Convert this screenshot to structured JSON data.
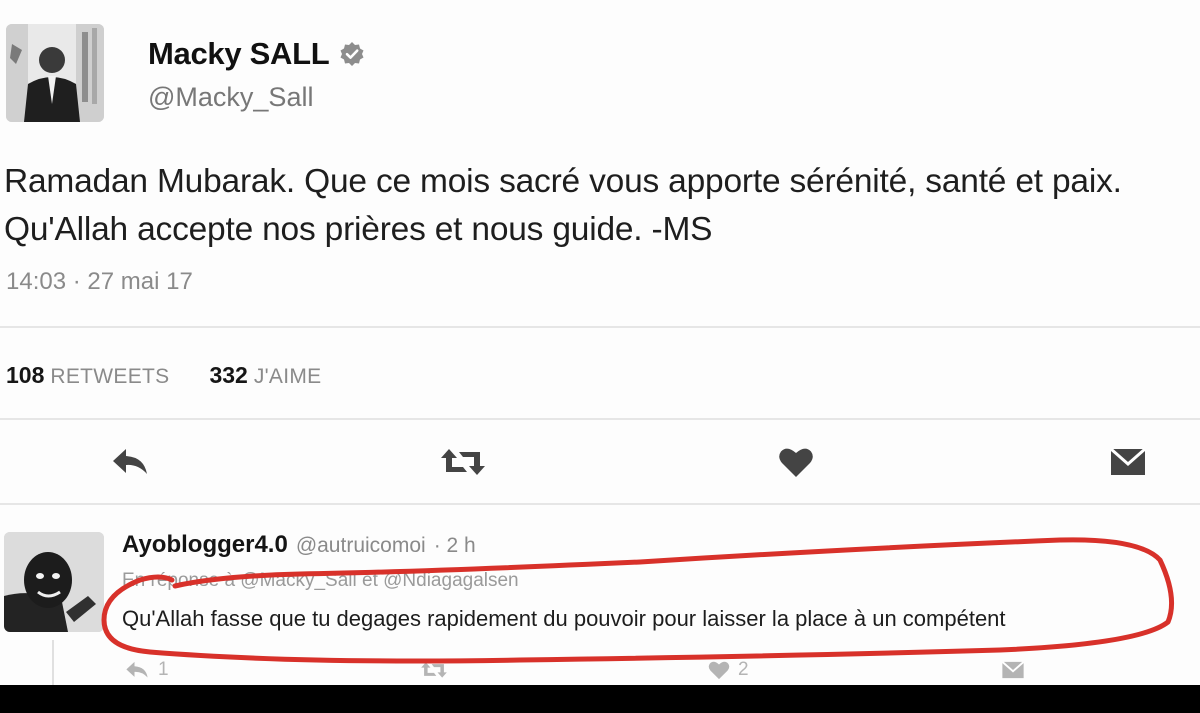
{
  "tweet": {
    "author_name": "Macky SALL",
    "author_handle": "@Macky_Sall",
    "text": "Ramadan Mubarak. Que ce mois sacré vous apporte sérénité, santé et paix. Qu'Allah accepte nos prières et nous guide. -MS",
    "timestamp": "14:03 · 27 mai 17",
    "retweets_count": "108",
    "retweets_label": "RETWEETS",
    "likes_count": "332",
    "likes_label": "J'AIME",
    "actions": [
      "reply-icon",
      "retweet-icon",
      "heart-icon",
      "message-icon"
    ]
  },
  "reply": {
    "author_name": "Ayoblogger4.0",
    "author_handle": "@autruicomoi",
    "time": "· 2 h",
    "context": "En réponse à @Macky_Sall et @Ndiagagalsen",
    "text": "Qu'Allah fasse que tu degages rapidement du pouvoir pour laisser la place à un compétent",
    "reply_count": "1",
    "like_count": "2"
  },
  "colors": {
    "annotation_red": "#d8312a",
    "icon_dark": "#444444",
    "icon_light": "#b4b4b4"
  }
}
